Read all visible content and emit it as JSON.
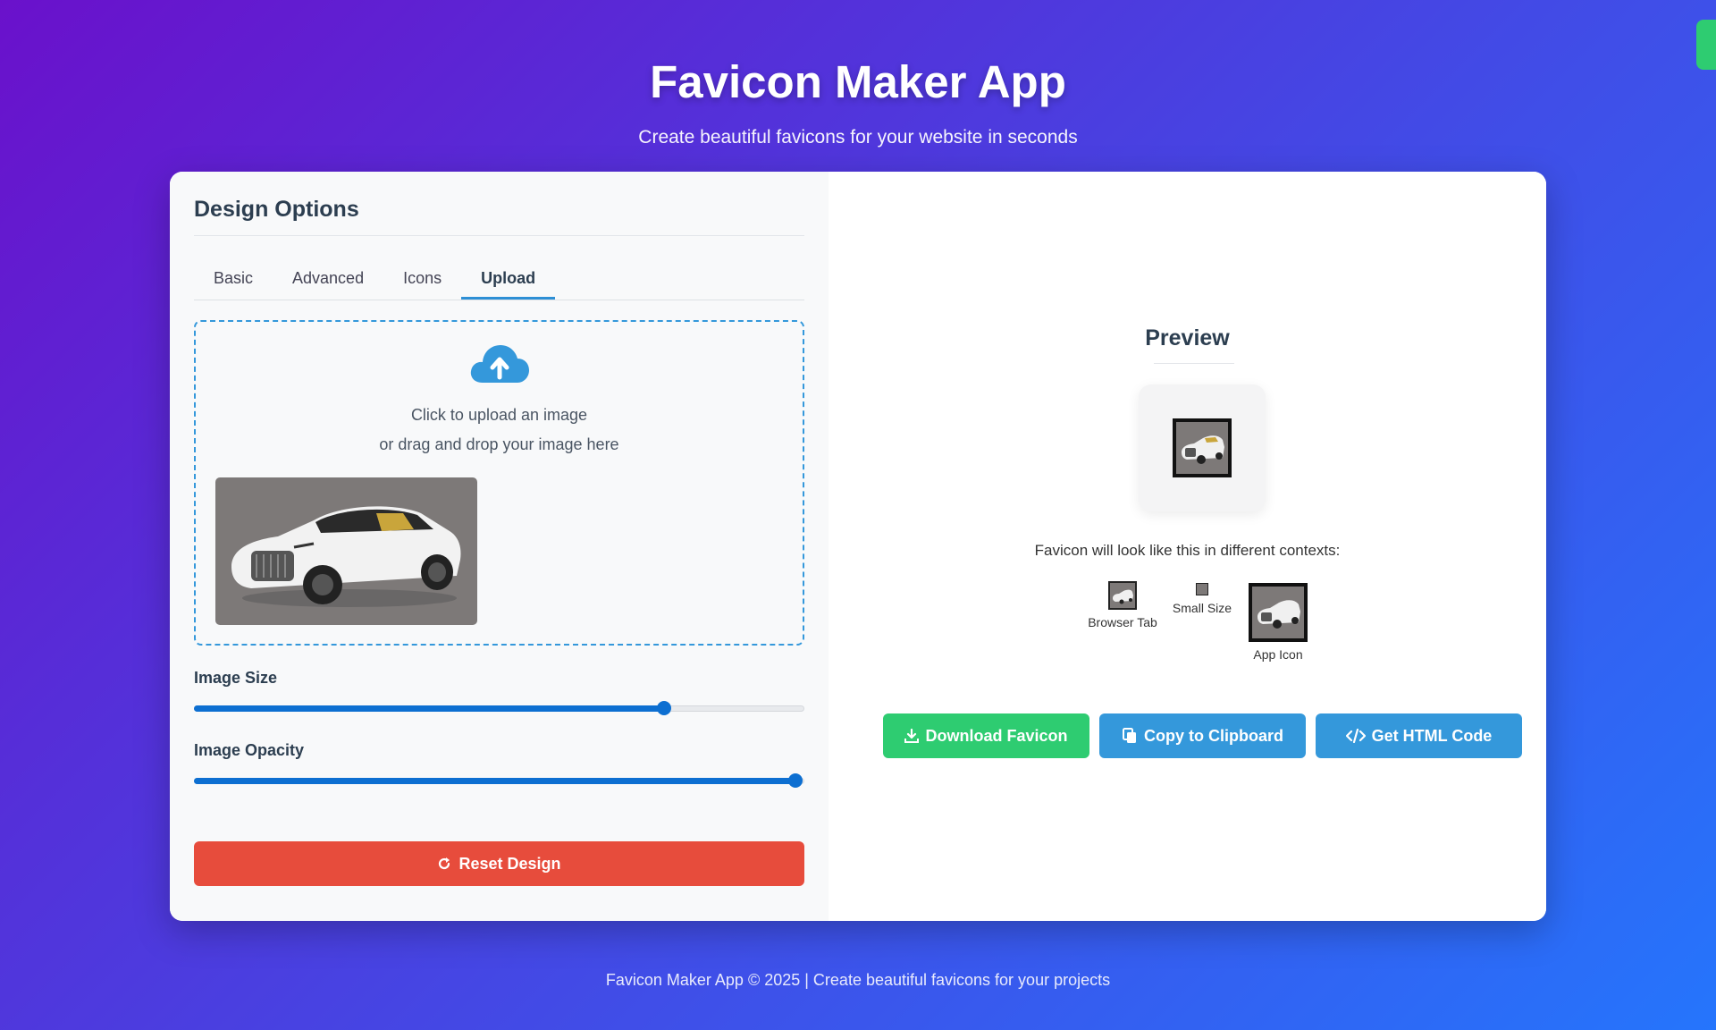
{
  "header": {
    "title": "Favicon Maker App",
    "subtitle": "Create beautiful favicons for your website in seconds"
  },
  "design_panel": {
    "title": "Design Options",
    "tabs": [
      {
        "label": "Basic",
        "active": false
      },
      {
        "label": "Advanced",
        "active": false
      },
      {
        "label": "Icons",
        "active": false
      },
      {
        "label": "Upload",
        "active": true
      }
    ],
    "upload": {
      "icon": "cloud-upload-icon",
      "line1": "Click to upload an image",
      "line2": "or drag and drop your image here",
      "image": "car-image"
    },
    "sliders": [
      {
        "label": "Image Size",
        "value_fraction": 0.77
      },
      {
        "label": "Image Opacity",
        "value_fraction": 0.985
      }
    ],
    "reset_label": "Reset Design"
  },
  "preview_panel": {
    "title": "Preview",
    "contexts_text": "Favicon will look like this in different contexts:",
    "contexts": [
      {
        "label": "Browser Tab"
      },
      {
        "label": "Small Size"
      },
      {
        "label": "App Icon"
      }
    ],
    "actions": {
      "download": "Download Favicon",
      "copy": "Copy to Clipboard",
      "html": "Get HTML Code"
    }
  },
  "footer": {
    "text": "Favicon Maker App © 2025 | Create beautiful favicons for your projects"
  },
  "colors": {
    "accent_blue": "#3498db",
    "success_green": "#2ecc71",
    "danger_red": "#e74c3c",
    "slider_blue": "#0d6fd1"
  }
}
